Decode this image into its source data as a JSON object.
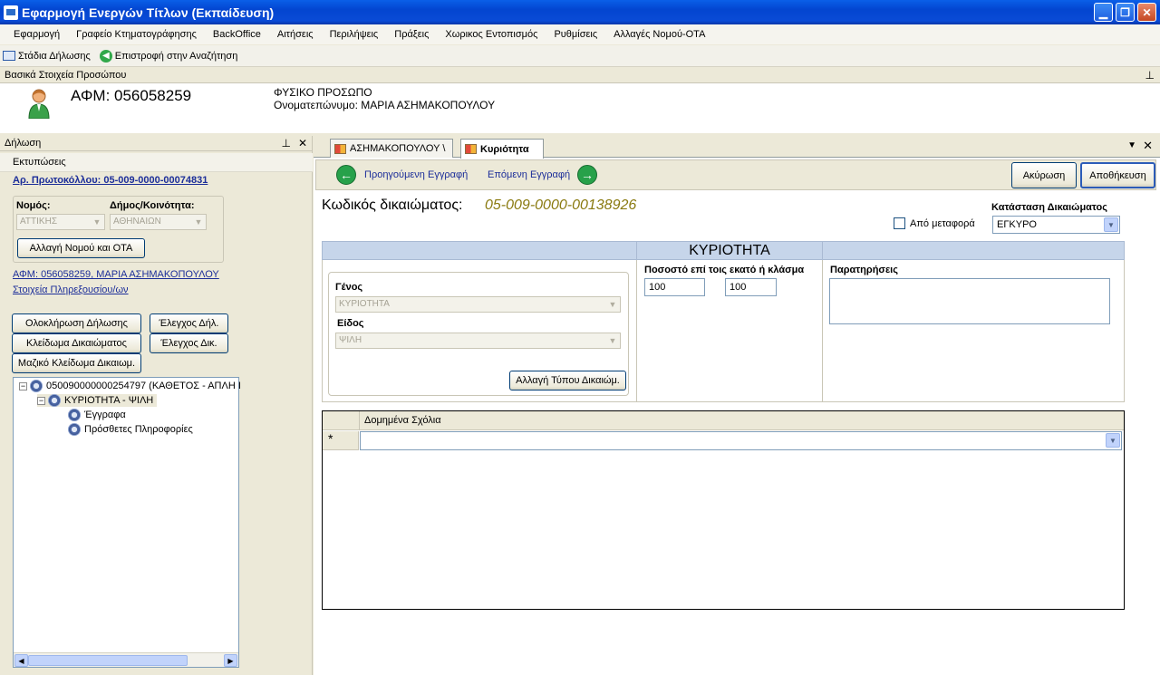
{
  "window": {
    "title": "Εφαρμογή Ενεργών Τίτλων (Εκπαίδευση)"
  },
  "menu": [
    "Εφαρμογή",
    "Γραφείο Κτηματογράφησης",
    "BackOffice",
    "Αιτήσεις",
    "Περιλήψεις",
    "Πράξεις",
    "Χωρικος Εντοπισμός",
    "Ρυθμίσεις",
    "Αλλαγές Νομού-ΟΤΑ"
  ],
  "toolbar": {
    "stages": "Στάδια Δήλωσης",
    "back_to_search": "Επιστροφή στην Αναζήτηση"
  },
  "person_panel": {
    "title": "Βασικά Στοιχεία Προσώπου",
    "afm": "ΑΦΜ: 056058259",
    "type": "ΦΥΣΙΚΟ ΠΡΟΣΩΠΟ",
    "fullname": "Ονοματεπώνυμο: ΜΑΡΙΑ ΑΣΗΜΑΚΟΠΟΥΛΟΥ"
  },
  "declaration": {
    "title": "Δήλωση",
    "prints": "Εκτυπώσεις",
    "protocol": "Αρ. Πρωτοκόλλου: 05-009-0000-00074831",
    "nomos_label": "Νομός:",
    "nomos_value": "ΑΤΤΙΚΗΣ",
    "dimos_label": "Δήμος/Κοινότητα:",
    "dimos_value": "ΑΘΗΝΑΙΩΝ",
    "change_nomos_btn": "Αλλαγή Νομού και ΟΤΑ",
    "afm_link": "ΑΦΜ: 056058259, ΜΑΡΙΑ ΑΣΗΜΑΚΟΠΟΥΛΟΥ",
    "proxy_link": "Στοιχεία Πληρεξουσίου/ων",
    "complete_btn": "Ολοκλήρωση Δήλωσης",
    "check_decl_btn": "Έλεγχος Δήλ.",
    "lock_right_btn": "Κλείδωμα Δικαιώματος",
    "check_right_btn": "Έλεγχος Δικ.",
    "mass_lock_btn": "Μαζικό Κλείδωμα Δικαιωμ.",
    "tree": {
      "root": "050090000000254797 (ΚΑΘΕΤΟΣ - ΑΠΛΗ Ι",
      "child": "ΚΥΡΙΟΤΗΤΑ - ΨΙΛΗ",
      "leaf1": "Έγγραφα",
      "leaf2": "Πρόσθετες Πληροφορίες"
    }
  },
  "tabs": [
    {
      "label": "ΑΣΗΜΑΚΟΠΟΥΛΟΥ \\"
    },
    {
      "label": "Κυριότητα"
    }
  ],
  "nav": {
    "prev": "Προηγούμενη Εγγραφή",
    "next": "Επόμενη Εγγραφή",
    "cancel": "Ακύρωση",
    "save": "Αποθήκευση"
  },
  "right": {
    "code_label": "Κωδικός δικαιώματος:",
    "code_value": "05-009-0000-00138926",
    "status_label": "Κατάσταση Δικαιώματος",
    "status_value": "ΕΓΚΥΡΟ",
    "transfer_label": "Από μεταφορά",
    "section_title": "ΚΥΡΙΟΤΗΤΑ",
    "genos_label": "Γένος",
    "genos_value": "ΚΥΡΙΟΤΗΤΑ",
    "eidos_label": "Είδος",
    "eidos_value": "ΨΙΛΗ",
    "change_type_btn": "Αλλαγή Τύπου Δικαιώμ.",
    "percent_label": "Ποσοστό επί τοις εκατό ή κλάσμα",
    "percent_value1": "100",
    "percent_value2": "100",
    "notes_label": "Παρατηρήσεις",
    "grid_header": "Δομημένα Σχόλια",
    "grid_newrow": "*"
  }
}
